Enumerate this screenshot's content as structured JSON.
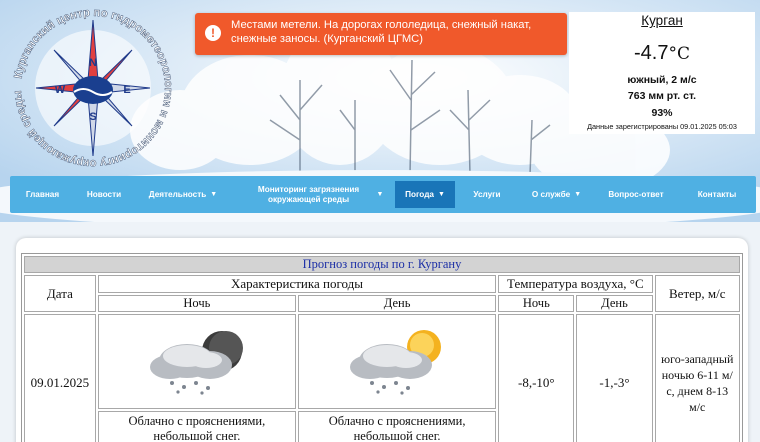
{
  "org": {
    "logo_text": "Курганский центр по гидрометеорологии и мониторингу окружающей среды",
    "compass_letters": [
      "N",
      "E",
      "S",
      "W"
    ]
  },
  "alert": {
    "icon": "exclamation-icon",
    "text": "Местами метели. На дорогах гололедица, снежный накат, снежные заносы. (Курганский ЦГМС)",
    "color": "#f0592b"
  },
  "current_weather": {
    "city": "Курган",
    "temp_value": "-4.7",
    "temp_unit": "°C",
    "wind": "южный, 2 м/с",
    "pressure": "763 мм рт. ст.",
    "humidity": "93%",
    "registered": "Данные зарегистрированы 09.01.2025 05:03"
  },
  "nav": {
    "accent": "#4fb0e3",
    "active_color": "#1975b8",
    "items": [
      {
        "label": "Главная",
        "has_dropdown": false
      },
      {
        "label": "Новости",
        "has_dropdown": false
      },
      {
        "label": "Деятельность",
        "has_dropdown": true
      },
      {
        "label": "Мониторинг загрязнения окружающей среды",
        "has_dropdown": true
      },
      {
        "label": "Погода",
        "has_dropdown": true,
        "active": true
      },
      {
        "label": "Услуги",
        "has_dropdown": false
      },
      {
        "label": "О службе",
        "has_dropdown": true
      },
      {
        "label": "Вопрос-ответ",
        "has_dropdown": false
      },
      {
        "label": "Контакты",
        "has_dropdown": false
      }
    ]
  },
  "forecast": {
    "title": "Прогноз погоды по г. Кургану",
    "headers": {
      "date": "Дата",
      "characteristics": "Характеристика погоды",
      "temperature": "Температура воздуха, °C",
      "wind": "Ветер, м/с",
      "night": "Ночь",
      "day": "День"
    },
    "rows": [
      {
        "date": "09.01.2025",
        "night_icon": "cloud-snow-moon-icon",
        "day_icon": "cloud-snow-sun-icon",
        "night_desc": "Облачно с прояснениями, небольшой снег.",
        "day_desc": "Облачно с прояснениями, небольшой снег.",
        "temp_night": "-8,-10°",
        "temp_day": "-1,-3°",
        "wind": "юго-западный ночью 6-11 м/с, днем 8-13 м/с"
      }
    ]
  }
}
